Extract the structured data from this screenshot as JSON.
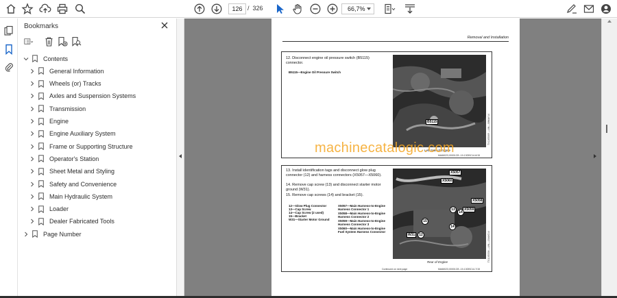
{
  "toolbar": {
    "current_page": "126",
    "page_separator": "/",
    "total_pages": "326",
    "zoom": "66,7%"
  },
  "bookmarks": {
    "title": "Bookmarks",
    "items": [
      {
        "label": "Contents",
        "level": 0,
        "expanded": true
      },
      {
        "label": "General Information",
        "level": 1
      },
      {
        "label": "Wheels (or) Tracks",
        "level": 1
      },
      {
        "label": "Axles and Suspension Systems",
        "level": 1
      },
      {
        "label": "Transmission",
        "level": 1
      },
      {
        "label": "Engine",
        "level": 1
      },
      {
        "label": "Engine Auxiliary System",
        "level": 1
      },
      {
        "label": "Frame or Supporting Structure",
        "level": 1
      },
      {
        "label": "Operator's Station",
        "level": 1
      },
      {
        "label": "Sheet Metal and Styling",
        "level": 1
      },
      {
        "label": "Safety and Convenience",
        "level": 1
      },
      {
        "label": "Main Hydraulic System",
        "level": 1
      },
      {
        "label": "Loader",
        "level": 1
      },
      {
        "label": "Dealer Fabricated Tools",
        "level": 1
      },
      {
        "label": "Page Number",
        "level": 0
      }
    ]
  },
  "document": {
    "header": "Removal and Installation",
    "step1": {
      "text": "12. Disconnect engine oil pressure switch (B5115) connector.",
      "legend": "B5115—Engine Oil Pressure Switch",
      "callout": "B5115",
      "caption": "Left Side of Engine",
      "side_code": "TX1165069 —UN—08MAY14",
      "foot_code": "MA66023,00001CB -19-13OBC14-6/15"
    },
    "step2": {
      "line13": "13. Install identification tags and disconnect glow plug connector (12) and harness connectors (X5057—X5060).",
      "line14": "14. Remove cap screw (13) and disconnect starter motor ground (W31).",
      "line15": "15. Remove cap screws (14) and bracket (15).",
      "legend_left": [
        "12—Glow Plug Connector",
        "13—Cap Screw",
        "14—Cap Screw (2 used)",
        "15—Bracket",
        "W31—Starter Motor Ground"
      ],
      "legend_right": [
        "X5057—Main Harness-to-Engine Harness Connector 1",
        "X5058—Main Harness-to-Engine Harness Connector 2",
        "X5059—Main Harness-to-Engine Harness Connector 3",
        "X5060—Main Harness-to-Engine Fuel System Harness Connector"
      ],
      "callouts": [
        "X5057",
        "X5060",
        "X5058",
        "X5059",
        "W31"
      ],
      "numbers": [
        "13",
        "14",
        "15",
        "14",
        "12"
      ],
      "caption": "Rear of Engine",
      "side_code": "TX1165334 —UN—13AUG14",
      "continued": "Continued on next page",
      "foot_code": "MA66023,00001CB -19-13OBC14-7/15"
    },
    "watermark": "machinecatalogic.com"
  }
}
